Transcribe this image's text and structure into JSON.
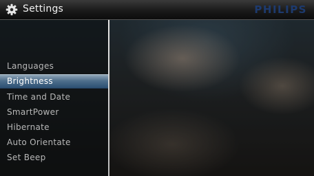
{
  "header": {
    "title": "Settings",
    "brand": "PHILIPS",
    "icon": "gear-icon"
  },
  "menu": {
    "selected_index": 1,
    "items": [
      {
        "label": "Languages"
      },
      {
        "label": "Brightness"
      },
      {
        "label": "Time and Date"
      },
      {
        "label": "SmartPower"
      },
      {
        "label": "Hibernate"
      },
      {
        "label": "Auto Orientate"
      },
      {
        "label": "Set Beep"
      }
    ]
  },
  "colors": {
    "highlight": "#4e6f8c",
    "brand": "#1d3a6e",
    "menu_text": "#b8b8b8"
  }
}
